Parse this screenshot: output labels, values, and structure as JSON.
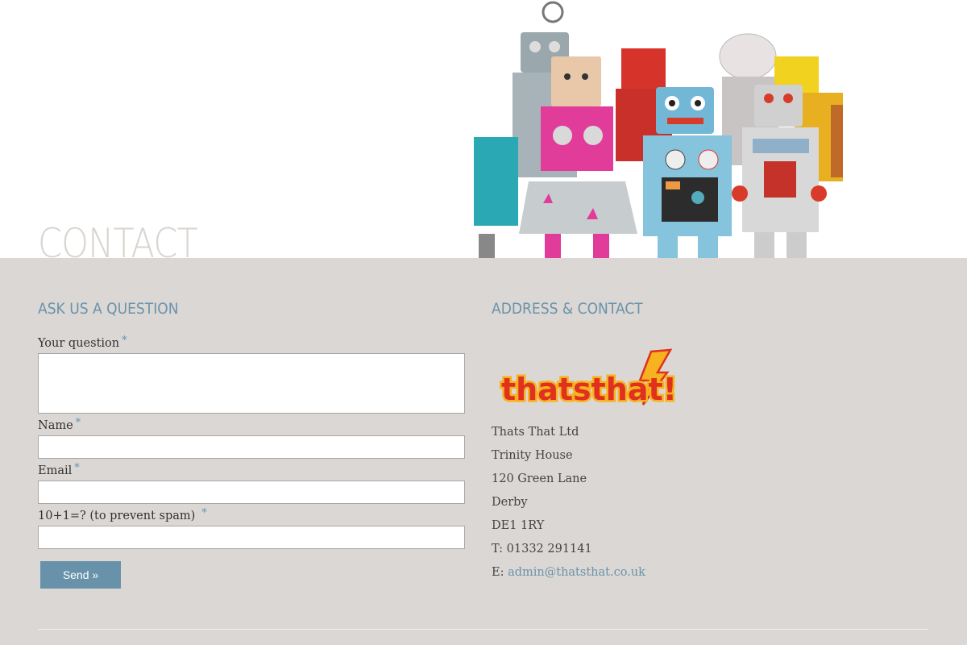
{
  "page": {
    "title": "CONTACT"
  },
  "form_section": {
    "heading": "ASK US A QUESTION",
    "fields": [
      {
        "label": "Your question",
        "required_mark": "*",
        "value": ""
      },
      {
        "label": "Name",
        "required_mark": "*",
        "value": ""
      },
      {
        "label": "Email",
        "required_mark": "*",
        "value": ""
      },
      {
        "label": "10+1=? (to prevent spam)",
        "required_mark": "*",
        "value": ""
      }
    ],
    "submit_label": "Send »"
  },
  "address_section": {
    "heading": "ADDRESS & CONTACT",
    "logo_text": "thatsthat!",
    "lines": [
      "Thats That Ltd",
      "Trinity House",
      "120 Green Lane",
      "Derby",
      "DE1 1RY",
      "T: 01332 291141"
    ],
    "email_prefix": "E:",
    "email": "admin@thatsthat.co.uk"
  },
  "colors": {
    "accent": "#6a93ab",
    "background": "#dbd7d4",
    "title": "#d9d4cf",
    "button": "#6892a9"
  }
}
